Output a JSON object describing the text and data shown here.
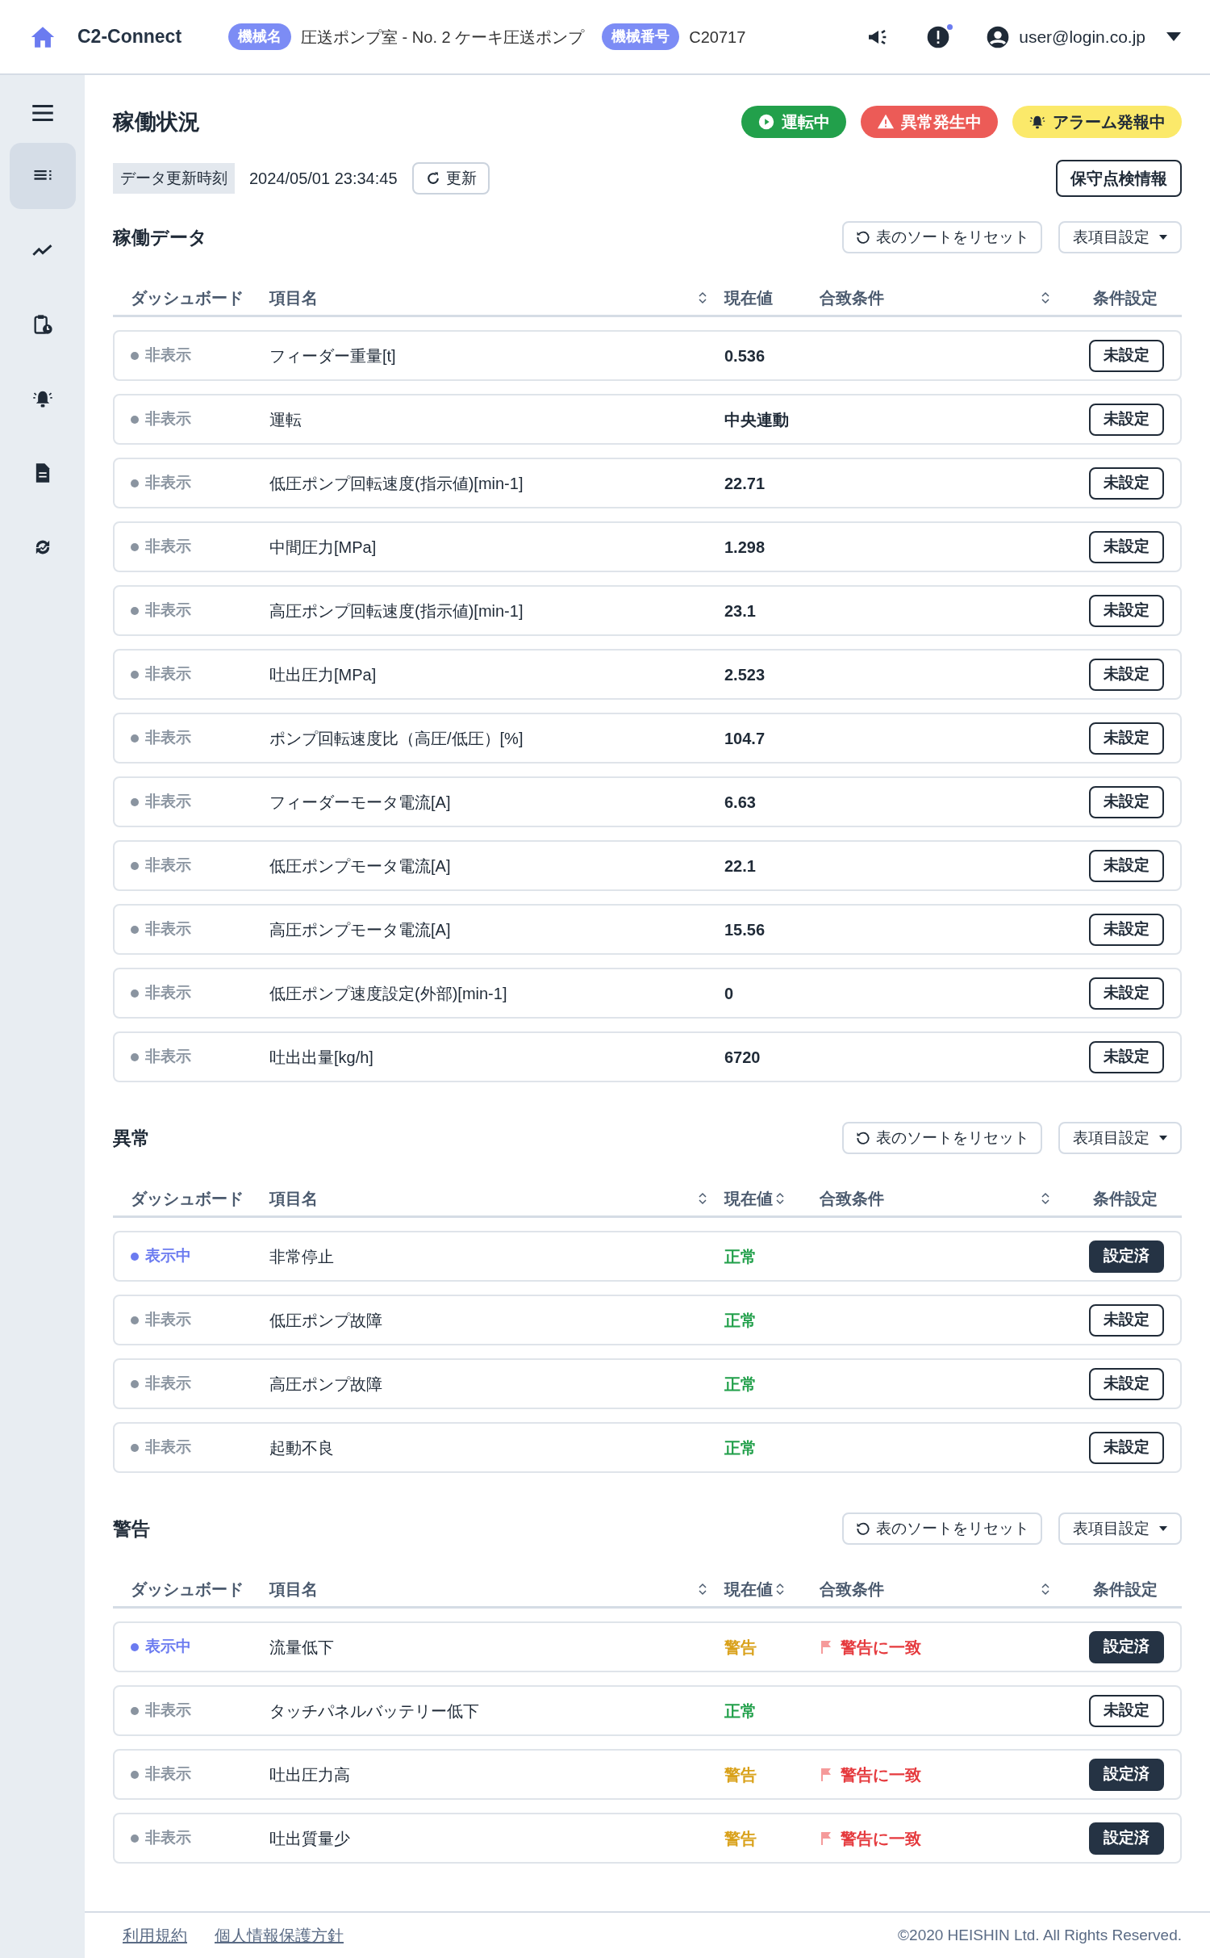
{
  "header": {
    "app_name": "C2-Connect",
    "badges": [
      {
        "label": "機械名",
        "value": "圧送ポンプ室 - No. 2 ケーキ圧送ポンプ"
      },
      {
        "label": "機械番号",
        "value": "C20717"
      }
    ],
    "notification_unread": true,
    "user": "user@login.co.jp"
  },
  "sidebar": {
    "items": [
      {
        "kind": "list",
        "selected": true
      },
      {
        "kind": "trend",
        "selected": false
      },
      {
        "kind": "maintenance",
        "selected": false
      },
      {
        "kind": "alarm",
        "selected": false
      },
      {
        "kind": "document",
        "selected": false
      },
      {
        "kind": "sync",
        "selected": false
      }
    ]
  },
  "page": {
    "title": "稼働状況",
    "statuses": [
      {
        "kind": "running",
        "label": "運転中"
      },
      {
        "kind": "error",
        "label": "異常発生中"
      },
      {
        "kind": "alarm",
        "label": "アラーム発報中"
      }
    ],
    "update_label": "データ更新時刻",
    "update_time": "2024/05/01 23:34:45",
    "refresh_button": "更新",
    "maintenance_button": "保守点検情報"
  },
  "sections": [
    {
      "title": "稼働データ",
      "reset_button": "表のソートをリセット",
      "settings_button": "表項目設定",
      "columns": [
        {
          "label": "ダッシュボード",
          "sortable": false
        },
        {
          "label": "項目名",
          "sortable": true
        },
        {
          "label": "現在値",
          "sortable": false
        },
        {
          "label": "合致条件",
          "sortable": true
        },
        {
          "label": "条件設定",
          "sortable": false
        }
      ],
      "rows": [
        {
          "dashboard": "非表示",
          "shown": false,
          "name": "フィーダー重量[t]",
          "value": {
            "kind": "number",
            "text": "0.536"
          },
          "button": "未設定",
          "configured": false
        },
        {
          "dashboard": "非表示",
          "shown": false,
          "name": "運転",
          "value": {
            "kind": "number",
            "text": "中央連動"
          },
          "button": "未設定",
          "configured": false
        },
        {
          "dashboard": "非表示",
          "shown": false,
          "name": "低圧ポンプ回転速度(指示値)[min-1]",
          "value": {
            "kind": "number",
            "text": "22.71"
          },
          "button": "未設定",
          "configured": false
        },
        {
          "dashboard": "非表示",
          "shown": false,
          "name": "中間圧力[MPa]",
          "value": {
            "kind": "number",
            "text": "1.298"
          },
          "button": "未設定",
          "configured": false
        },
        {
          "dashboard": "非表示",
          "shown": false,
          "name": "高圧ポンプ回転速度(指示値)[min-1]",
          "value": {
            "kind": "number",
            "text": "23.1"
          },
          "button": "未設定",
          "configured": false
        },
        {
          "dashboard": "非表示",
          "shown": false,
          "name": "吐出圧力[MPa]",
          "value": {
            "kind": "number",
            "text": "2.523"
          },
          "button": "未設定",
          "configured": false
        },
        {
          "dashboard": "非表示",
          "shown": false,
          "name": "ポンプ回転速度比（高圧/低圧）[%]",
          "value": {
            "kind": "number",
            "text": "104.7"
          },
          "button": "未設定",
          "configured": false
        },
        {
          "dashboard": "非表示",
          "shown": false,
          "name": "フィーダーモータ電流[A]",
          "value": {
            "kind": "number",
            "text": "6.63"
          },
          "button": "未設定",
          "configured": false
        },
        {
          "dashboard": "非表示",
          "shown": false,
          "name": "低圧ポンプモータ電流[A]",
          "value": {
            "kind": "number",
            "text": "22.1"
          },
          "button": "未設定",
          "configured": false
        },
        {
          "dashboard": "非表示",
          "shown": false,
          "name": "高圧ポンプモータ電流[A]",
          "value": {
            "kind": "number",
            "text": "15.56"
          },
          "button": "未設定",
          "configured": false
        },
        {
          "dashboard": "非表示",
          "shown": false,
          "name": "低圧ポンプ速度設定(外部)[min-1]",
          "value": {
            "kind": "number",
            "text": "0"
          },
          "button": "未設定",
          "configured": false
        },
        {
          "dashboard": "非表示",
          "shown": false,
          "name": "吐出出量[kg/h]",
          "value": {
            "kind": "number",
            "text": "6720"
          },
          "button": "未設定",
          "configured": false
        }
      ]
    },
    {
      "title": "異常",
      "reset_button": "表のソートをリセット",
      "settings_button": "表項目設定",
      "columns": [
        {
          "label": "ダッシュボード",
          "sortable": false
        },
        {
          "label": "項目名",
          "sortable": true
        },
        {
          "label": "現在値",
          "sortable": true
        },
        {
          "label": "合致条件",
          "sortable": true
        },
        {
          "label": "条件設定",
          "sortable": false
        }
      ],
      "rows": [
        {
          "dashboard": "表示中",
          "shown": true,
          "name": "非常停止",
          "value": {
            "kind": "normal",
            "text": "正常"
          },
          "button": "設定済",
          "configured": true
        },
        {
          "dashboard": "非表示",
          "shown": false,
          "name": "低圧ポンプ故障",
          "value": {
            "kind": "normal",
            "text": "正常"
          },
          "button": "未設定",
          "configured": false
        },
        {
          "dashboard": "非表示",
          "shown": false,
          "name": "高圧ポンプ故障",
          "value": {
            "kind": "normal",
            "text": "正常"
          },
          "button": "未設定",
          "configured": false
        },
        {
          "dashboard": "非表示",
          "shown": false,
          "name": "起動不良",
          "value": {
            "kind": "normal",
            "text": "正常"
          },
          "button": "未設定",
          "configured": false
        }
      ]
    },
    {
      "title": "警告",
      "reset_button": "表のソートをリセット",
      "settings_button": "表項目設定",
      "columns": [
        {
          "label": "ダッシュボード",
          "sortable": false
        },
        {
          "label": "項目名",
          "sortable": true
        },
        {
          "label": "現在値",
          "sortable": true
        },
        {
          "label": "合致条件",
          "sortable": true
        },
        {
          "label": "条件設定",
          "sortable": false
        }
      ],
      "rows": [
        {
          "dashboard": "表示中",
          "shown": true,
          "name": "流量低下",
          "value": {
            "kind": "warning",
            "text": "警告"
          },
          "condition": "警告に一致",
          "button": "設定済",
          "configured": true
        },
        {
          "dashboard": "非表示",
          "shown": false,
          "name": "タッチパネルバッテリー低下",
          "value": {
            "kind": "normal",
            "text": "正常"
          },
          "button": "未設定",
          "configured": false
        },
        {
          "dashboard": "非表示",
          "shown": false,
          "name": "吐出圧力高",
          "value": {
            "kind": "warning",
            "text": "警告"
          },
          "condition": "警告に一致",
          "button": "設定済",
          "configured": true
        },
        {
          "dashboard": "非表示",
          "shown": false,
          "name": "吐出質量少",
          "value": {
            "kind": "warning",
            "text": "警告"
          },
          "condition": "警告に一致",
          "button": "設定済",
          "configured": true
        }
      ]
    }
  ],
  "footer": {
    "links": [
      "利用規約",
      "個人情報保護方針"
    ],
    "copyright": "©2020 HEISHIN Ltd. All Rights Reserved."
  }
}
